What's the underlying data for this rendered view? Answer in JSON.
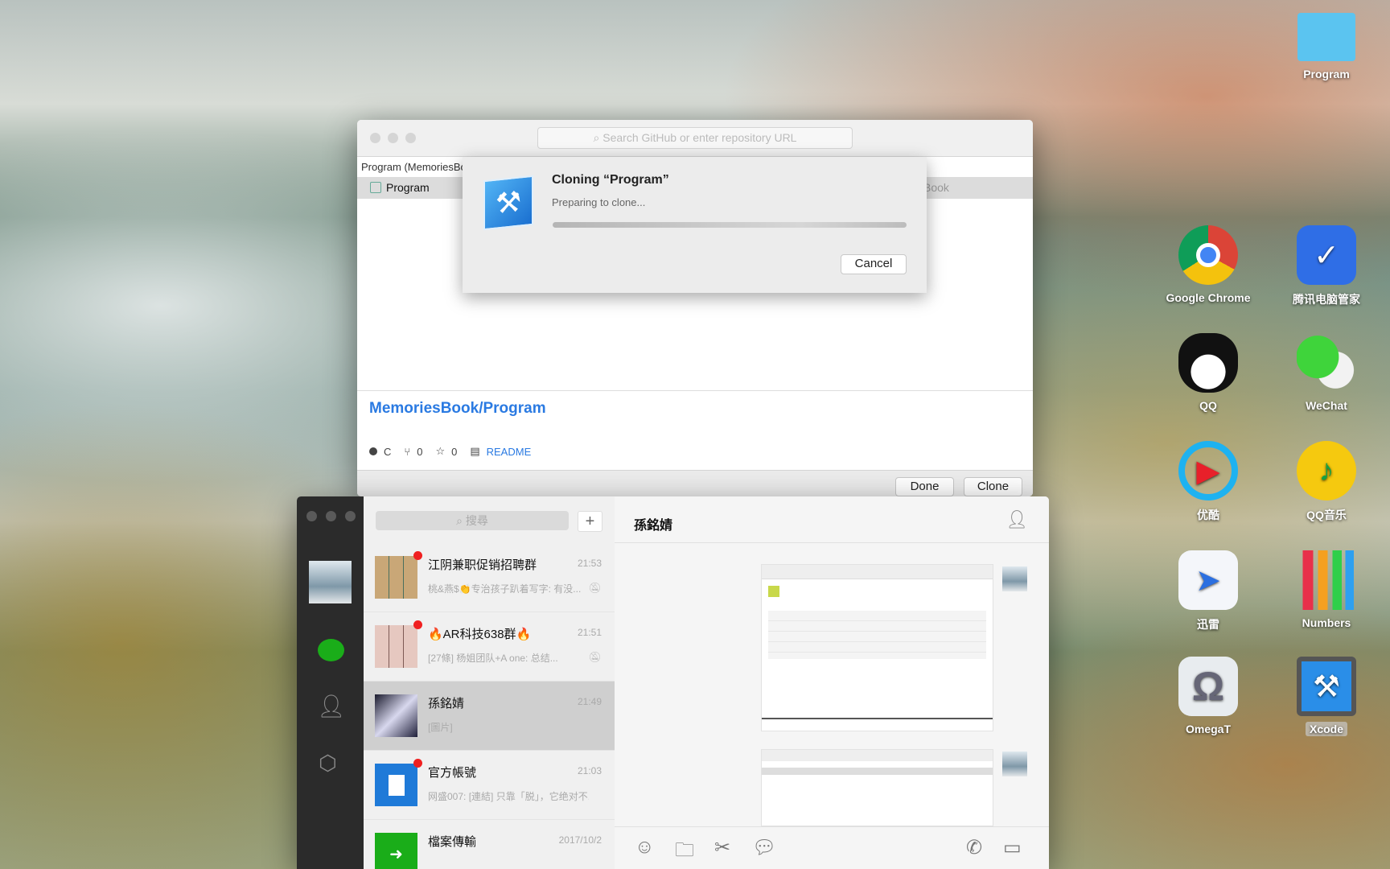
{
  "desktop": {
    "icons": [
      {
        "label": "Program",
        "icon": "folder-icon"
      },
      {
        "label": "Google Chrome",
        "icon": "chrome-icon"
      },
      {
        "label": "腾讯电脑管家",
        "icon": "tencent-pc-manager-icon"
      },
      {
        "label": "QQ",
        "icon": "qq-icon"
      },
      {
        "label": "WeChat",
        "icon": "wechat-icon"
      },
      {
        "label": "优酷",
        "icon": "youku-icon"
      },
      {
        "label": "QQ音乐",
        "icon": "qq-music-icon"
      },
      {
        "label": "迅雷",
        "icon": "xunlei-icon"
      },
      {
        "label": "Numbers",
        "icon": "numbers-icon"
      },
      {
        "label": "OmegaT",
        "icon": "omegat-icon"
      },
      {
        "label": "Xcode",
        "icon": "xcode-icon"
      }
    ]
  },
  "xcode": {
    "search_placeholder": "Search GitHub or enter repository URL",
    "column_header": "Program (MemoriesBook)",
    "row_name": "Program",
    "row_owner_partial": "Book",
    "repo_title": "MemoriesBook/Program",
    "language": "C",
    "forks": "0",
    "stars": "0",
    "readme": "README",
    "done": "Done",
    "clone": "Clone",
    "sheet": {
      "title": "Cloning “Program”",
      "status": "Preparing to clone...",
      "progress": 0,
      "cancel": "Cancel"
    }
  },
  "wechat": {
    "search_placeholder": "搜尋",
    "add": "+",
    "chat_title": "孫銘婧",
    "chats": [
      {
        "name": "江阴兼职促销招聘群",
        "time": "21:53",
        "preview": "桃&燕$👏专治孩子趴着写字: 有没...",
        "unread": true,
        "muted": true
      },
      {
        "name": "🔥AR科技638群🔥",
        "time": "21:51",
        "preview": "[27條] 杨姐团队+A one: 总结...",
        "unread": true,
        "muted": true
      },
      {
        "name": "孫銘婧",
        "time": "21:49",
        "preview": "[圖片]",
        "unread": false,
        "selected": true
      },
      {
        "name": "官方帳號",
        "time": "21:03",
        "preview": "网盛007: [連結] 只靠「脱」，它绝对不...",
        "unread": true
      },
      {
        "name": "檔案傳輸",
        "time": "2017/10/2",
        "preview": "",
        "unread": false
      }
    ]
  },
  "colors": {
    "accent": "#2a7ae2",
    "wechat_green": "#1aad19",
    "badge": "#f02020"
  }
}
